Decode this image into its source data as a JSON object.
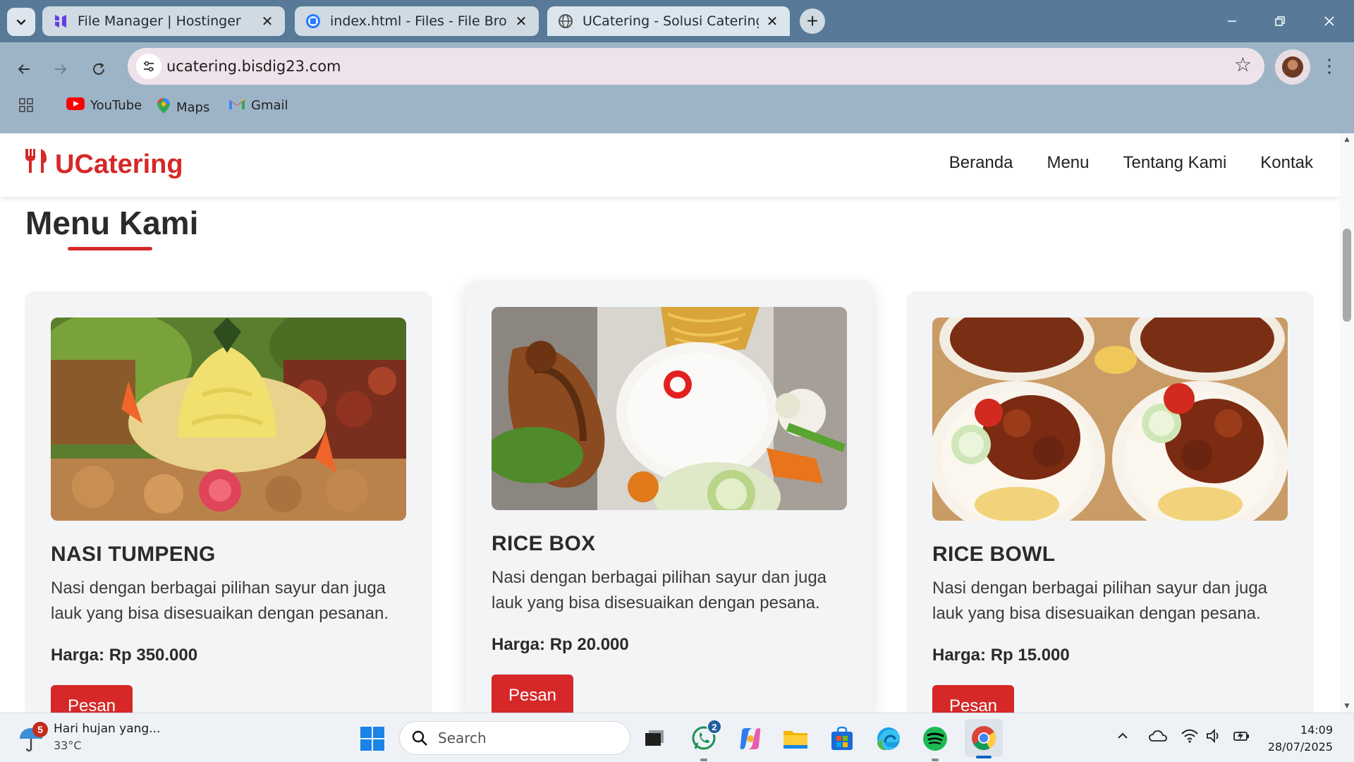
{
  "browser": {
    "tabs": [
      {
        "title": "File Manager | Hostinger",
        "active": false
      },
      {
        "title": "index.html - Files - File Browser",
        "active": false
      },
      {
        "title": "UCatering - Solusi Catering Berku",
        "active": true
      }
    ],
    "url": "ucatering.bisdig23.com",
    "bookmarks": [
      {
        "label": "YouTube"
      },
      {
        "label": "Maps"
      },
      {
        "label": "Gmail"
      }
    ]
  },
  "site": {
    "brand": "UCatering",
    "brand_color": "#d62828",
    "nav": [
      "Beranda",
      "Menu",
      "Tentang Kami",
      "Kontak"
    ],
    "section_title": "Menu Kami",
    "price_prefix": "Harga: ",
    "menu": [
      {
        "name": "NASI TUMPENG",
        "description": "Nasi dengan berbagai pilihan sayur dan juga lauk yang bisa disesuaikan dengan pesanan.",
        "price": "Harga: Rp 350.000",
        "button": "Pesan"
      },
      {
        "name": "RICE BOX",
        "description": "Nasi dengan berbagai pilihan sayur dan juga lauk yang bisa disesuaikan dengan pesana.",
        "price": "Harga: Rp 20.000",
        "button": "Pesan"
      },
      {
        "name": "RICE BOWL",
        "description": "Nasi dengan berbagai pilihan sayur dan juga lauk yang bisa disesuaikan dengan pesana.",
        "price": "Harga: Rp 15.000",
        "button": "Pesan"
      }
    ]
  },
  "taskbar": {
    "weather_text": "Hari hujan yang...",
    "weather_temp": "33°C",
    "weather_badge": "5",
    "search_placeholder": "Search",
    "whatsapp_badge": "2",
    "time": "14:09",
    "date": "28/07/2025"
  }
}
